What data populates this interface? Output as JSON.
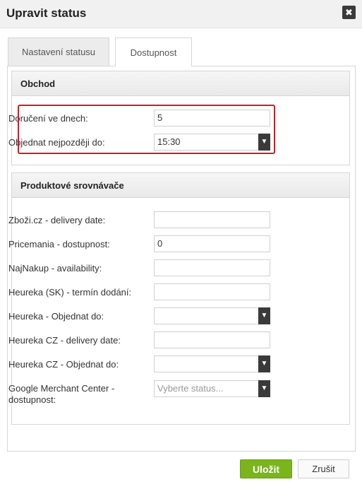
{
  "dialog": {
    "title": "Upravit status",
    "close_symbol": "✖"
  },
  "tabs": [
    {
      "label": "Nastavení statusu",
      "active": false
    },
    {
      "label": "Dostupnost",
      "active": true
    }
  ],
  "shop": {
    "header": "Obchod",
    "delivery_days_label": "Doručení ve dnech:",
    "delivery_days_value": "5",
    "order_by_label": "Objednat nejpozději do:",
    "order_by_value": "15:30"
  },
  "comparators": {
    "header": "Produktové srovnávače",
    "rows": [
      {
        "label": "Zboži.cz - delivery date:",
        "value": "",
        "type": "text"
      },
      {
        "label": "Pricemania - dostupnost:",
        "value": "0",
        "type": "text"
      },
      {
        "label": "NajNakup - availability:",
        "value": "",
        "type": "text"
      },
      {
        "label": "Heureka (SK) - termín dodání:",
        "value": "",
        "type": "text"
      },
      {
        "label": "Heureka - Objednat do:",
        "value": "",
        "type": "select"
      },
      {
        "label": "Heureka CZ - delivery date:",
        "value": "",
        "type": "text"
      },
      {
        "label": "Heureka CZ - Objednat do:",
        "value": "",
        "type": "select"
      },
      {
        "label_line1": "Google Merchant Center -",
        "label_line2": "dostupnost:",
        "value": "",
        "placeholder": "Vyberte status...",
        "type": "select"
      }
    ]
  },
  "actions": {
    "save_label": "Uložit",
    "cancel_label": "Zrušit"
  },
  "colors": {
    "save_button": "#7ab51d",
    "highlight": "#e0151d",
    "select_arrow": "#3a3a3a"
  },
  "icons": {
    "close": "close-icon",
    "dropdown": "chevron-down-icon"
  }
}
